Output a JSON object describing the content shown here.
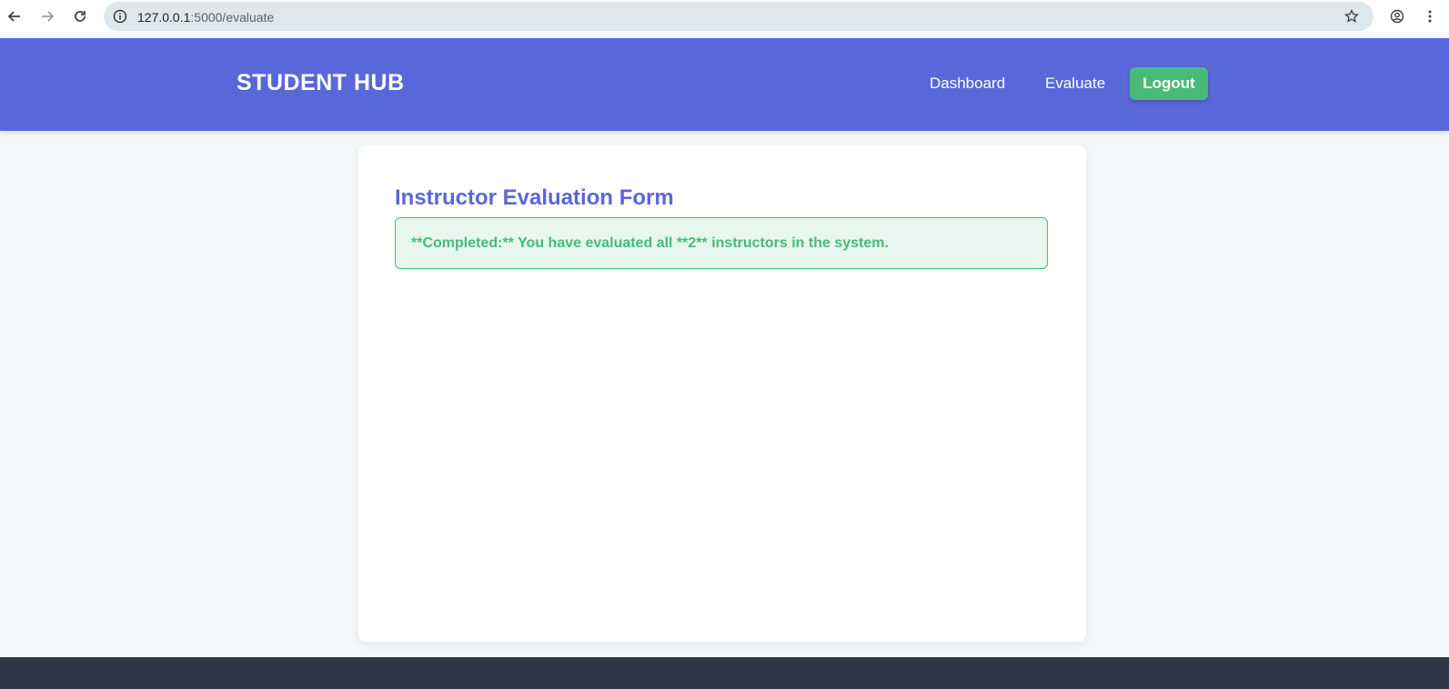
{
  "browser": {
    "url_host": "127.0.0.1",
    "url_path": ":5000/evaluate"
  },
  "header": {
    "brand": "STUDENT HUB",
    "nav": {
      "dashboard": "Dashboard",
      "evaluate": "Evaluate",
      "logout": "Logout"
    }
  },
  "main": {
    "title": "Instructor Evaluation Form",
    "alert": "**Completed:** You have evaluated all **2** instructors in the system."
  },
  "colors": {
    "primary": "#5a67d8",
    "success": "#48bb78",
    "footer": "#2d3748",
    "page_bg": "#f4f8fb"
  }
}
